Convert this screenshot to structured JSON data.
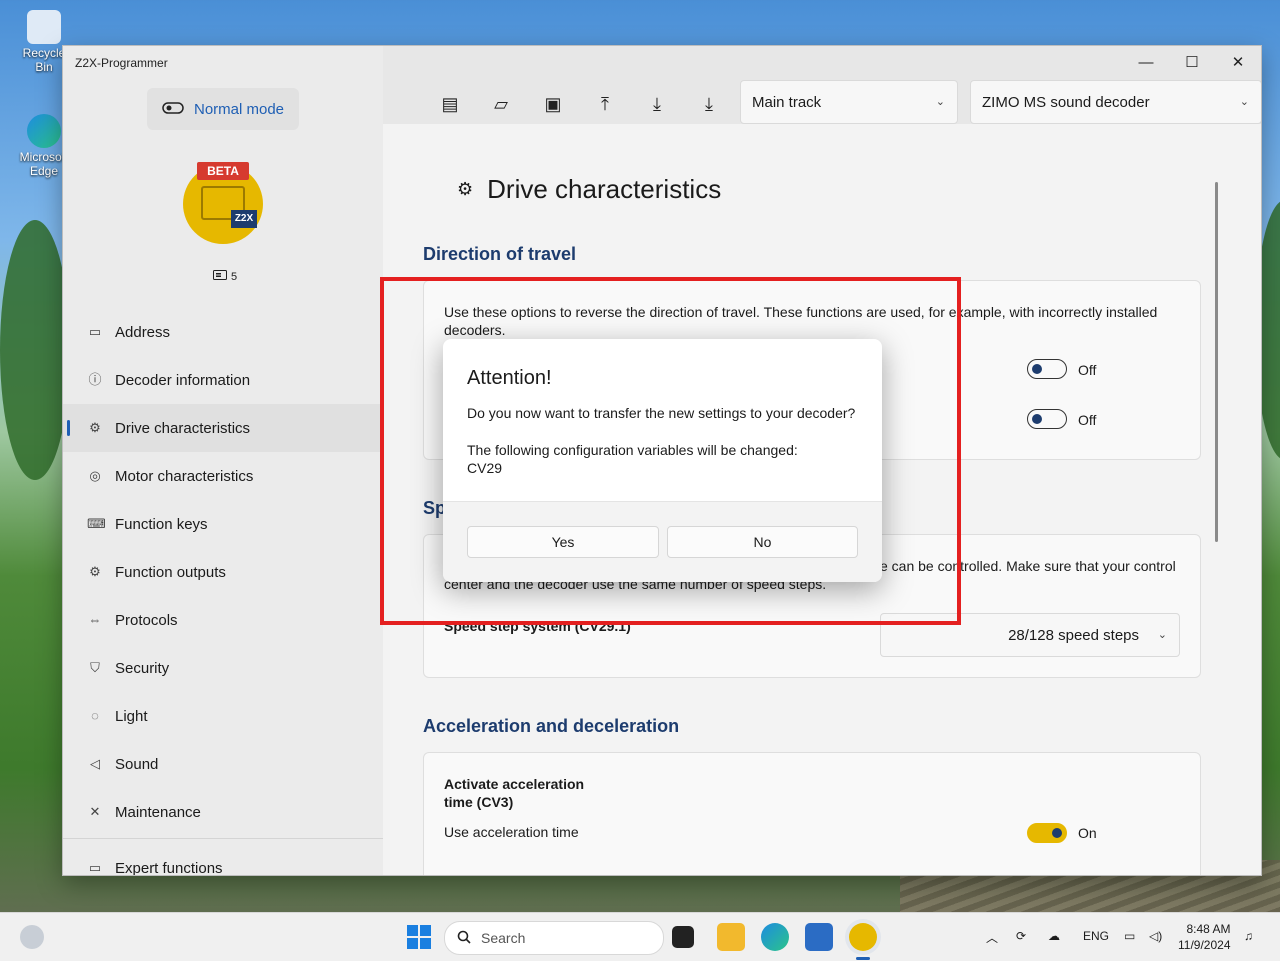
{
  "desktop": {
    "icons": [
      {
        "label": "Recycle Bin"
      },
      {
        "label": "Microsoft Edge"
      }
    ]
  },
  "window": {
    "title": "Z2X-Programmer",
    "mode_label": "Normal mode",
    "logo": {
      "badge": "BETA",
      "mark": "Z2X"
    },
    "decoder_count": "5"
  },
  "sidebar": {
    "items": [
      {
        "label": "Address"
      },
      {
        "label": "Decoder information"
      },
      {
        "label": "Drive characteristics"
      },
      {
        "label": "Motor characteristics"
      },
      {
        "label": "Function keys"
      },
      {
        "label": "Function outputs"
      },
      {
        "label": "Protocols"
      },
      {
        "label": "Security"
      },
      {
        "label": "Light"
      },
      {
        "label": "Sound"
      },
      {
        "label": "Maintenance"
      }
    ],
    "expert": "Expert functions"
  },
  "toolbar": {
    "track": "Main track",
    "decoder": "ZIMO MS sound decoder"
  },
  "page": {
    "title": "Drive characteristics",
    "direction": {
      "title": "Direction of travel",
      "desc": "Use these options to reverse the direction of travel. These functions are used, for example, with incorrectly installed decoders.",
      "toggle1": "Off",
      "toggle2": "Off"
    },
    "speed": {
      "title": "Sp",
      "desc_tail": "e can be controlled. Make sure that your control",
      "desc_line2": "center and the decoder use the same number of speed steps.",
      "field_label": "Speed step system (CV29.1)",
      "value": "28/128 speed steps"
    },
    "accel": {
      "title": "Acceleration and deceleration",
      "setting_title": "Activate acceleration time (CV3)",
      "setting_desc": "Use acceleration time",
      "toggle": "On"
    }
  },
  "dialog": {
    "title": "Attention!",
    "question": "Do you now want to transfer the new settings to your decoder?",
    "info": "The following configuration variables will be changed:",
    "cv": "CV29",
    "yes": "Yes",
    "no": "No"
  },
  "taskbar": {
    "search_placeholder": "Search",
    "lang": "ENG",
    "time": "8:48 AM",
    "date": "11/9/2024"
  },
  "colors": {
    "accent": "#1f5fb4",
    "section": "#1d3c6e",
    "highlight": "#e42020",
    "brand_yellow": "#e6b800"
  }
}
